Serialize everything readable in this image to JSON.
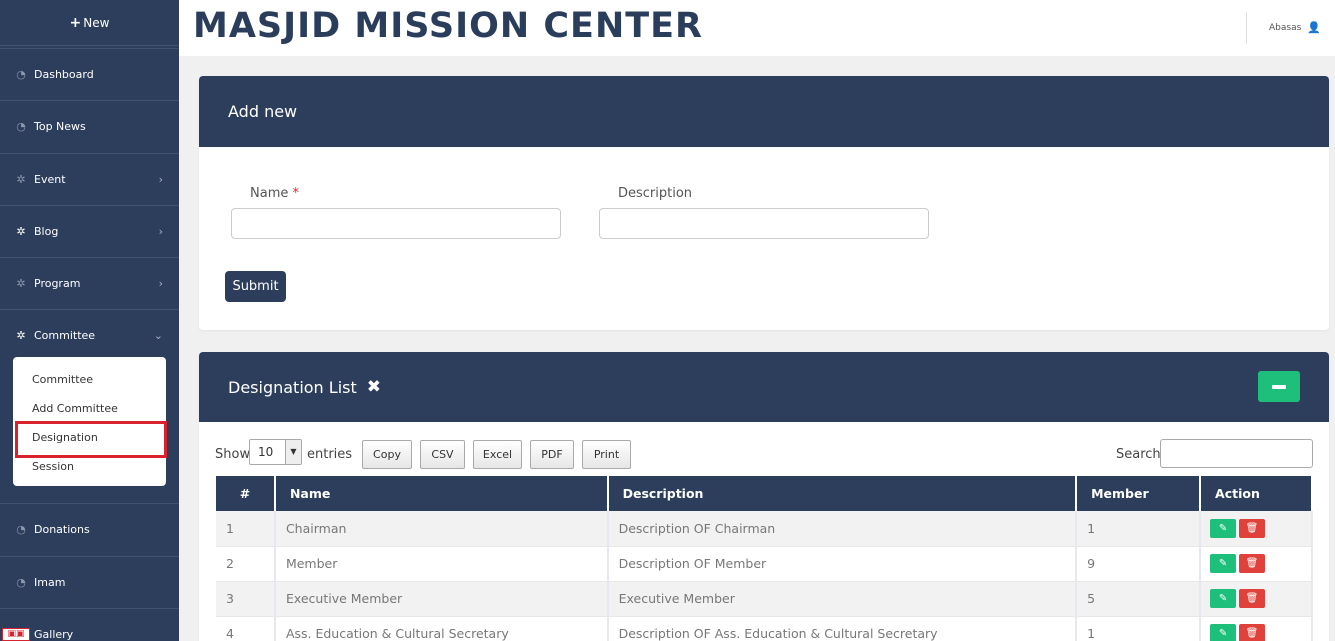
{
  "sidebar": {
    "new_label": "New",
    "items": [
      {
        "label": "Dashboard"
      },
      {
        "label": "Top News"
      },
      {
        "label": "Event"
      },
      {
        "label": "Blog"
      },
      {
        "label": "Program"
      },
      {
        "label": "Committee"
      },
      {
        "label": "Donations"
      },
      {
        "label": "Imam"
      },
      {
        "label": "Gallery"
      }
    ],
    "submenu": [
      {
        "label": "Committee"
      },
      {
        "label": "Add Committee"
      },
      {
        "label": "Designation"
      },
      {
        "label": "Session"
      }
    ]
  },
  "header": {
    "brand": "MASJID MISSION CENTER",
    "user_name": "Abasas"
  },
  "add_form": {
    "title": "Add new",
    "name_label": "Name",
    "required_mark": "*",
    "description_label": "Description",
    "name_value": "",
    "description_value": "",
    "submit_label": "Submit"
  },
  "designation_list": {
    "title": "Designation List",
    "show_label": "Show",
    "page_size": "10",
    "entries_label": "entries",
    "export_buttons": [
      "Copy",
      "CSV",
      "Excel",
      "PDF",
      "Print"
    ],
    "search_label": "Search:",
    "search_value": "",
    "columns": [
      "#",
      "Name",
      "Description",
      "Member",
      "Action"
    ],
    "rows": [
      {
        "num": "1",
        "name": "Chairman",
        "description": "Description OF Chairman",
        "member": "1"
      },
      {
        "num": "2",
        "name": "Member",
        "description": "Description OF Member",
        "member": "9"
      },
      {
        "num": "3",
        "name": "Executive Member",
        "description": "Executive Member",
        "member": "5"
      },
      {
        "num": "4",
        "name": "Ass. Education & Cultural Secretary",
        "description": "Description OF Ass. Education & Cultural Secretary",
        "member": "1"
      }
    ]
  },
  "colors": {
    "primary": "#2c3e5c",
    "success": "#1dbf7b",
    "danger": "#e0413a",
    "highlight": "#d9232c"
  }
}
